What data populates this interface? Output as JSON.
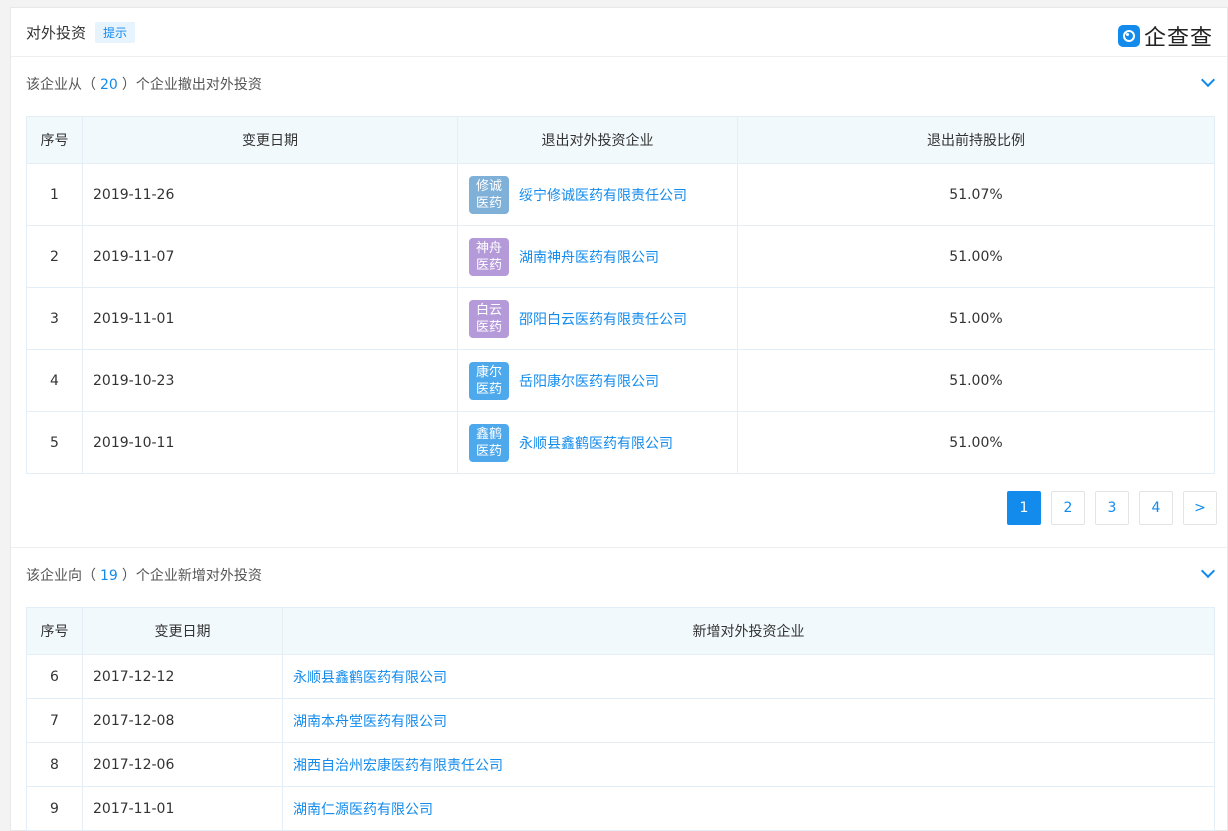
{
  "header": {
    "title": "对外投资",
    "tip": "提示",
    "logo_text": "企查查"
  },
  "section1": {
    "prefix": "该企业从（",
    "count": "20",
    "suffix": "）个企业撤出对外投资",
    "columns": [
      "序号",
      "变更日期",
      "退出对外投资企业",
      "退出前持股比例"
    ],
    "rows": [
      {
        "idx": "1",
        "date": "2019-11-26",
        "logo": "修诚\n医药",
        "logo_color": "#7fb0d8",
        "company": "绥宁修诚医药有限责任公司",
        "pct": "51.07%"
      },
      {
        "idx": "2",
        "date": "2019-11-07",
        "logo": "神舟\n医药",
        "logo_color": "#b59ad9",
        "company": "湖南神舟医药有限公司",
        "pct": "51.00%"
      },
      {
        "idx": "3",
        "date": "2019-11-01",
        "logo": "白云\n医药",
        "logo_color": "#b59ad9",
        "company": "邵阳白云医药有限责任公司",
        "pct": "51.00%"
      },
      {
        "idx": "4",
        "date": "2019-10-23",
        "logo": "康尔\n医药",
        "logo_color": "#4ea8ec",
        "company": "岳阳康尔医药有限公司",
        "pct": "51.00%"
      },
      {
        "idx": "5",
        "date": "2019-10-11",
        "logo": "鑫鹤\n医药",
        "logo_color": "#4ea8ec",
        "company": "永顺县鑫鹤医药有限公司",
        "pct": "51.00%"
      }
    ],
    "pages": [
      "1",
      "2",
      "3",
      "4",
      ">"
    ]
  },
  "section2": {
    "prefix": "该企业向（",
    "count": "19",
    "suffix": "）个企业新增对外投资",
    "columns": [
      "序号",
      "变更日期",
      "新增对外投资企业"
    ],
    "rows": [
      {
        "idx": "6",
        "date": "2017-12-12",
        "company": "永顺县鑫鹤医药有限公司"
      },
      {
        "idx": "7",
        "date": "2017-12-08",
        "company": "湖南本舟堂医药有限公司"
      },
      {
        "idx": "8",
        "date": "2017-12-06",
        "company": "湘西自治州宏康医药有限责任公司"
      },
      {
        "idx": "9",
        "date": "2017-11-01",
        "company": "湖南仁源医药有限公司"
      }
    ]
  }
}
